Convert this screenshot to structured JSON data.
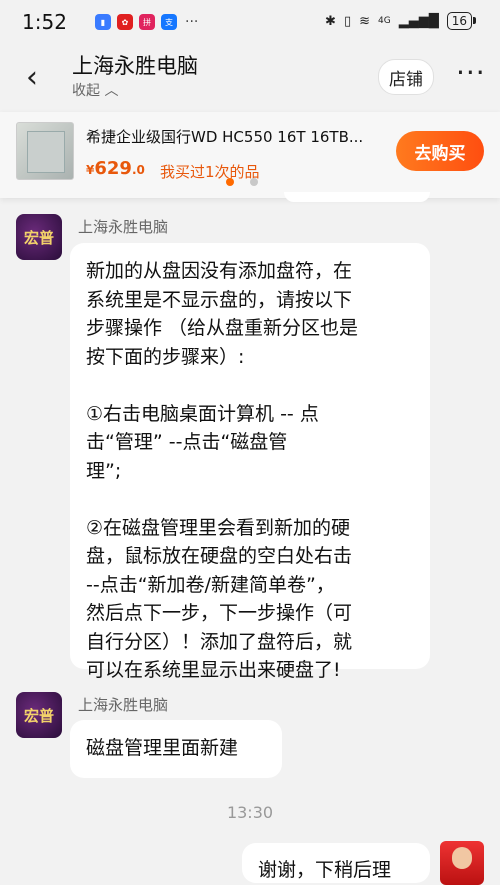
{
  "status_bar": {
    "time": "1:52",
    "notification_icons": [
      "voice-app-icon",
      "huawei-app-icon",
      "pinduoduo-app-icon",
      "alipay-app-icon"
    ],
    "more": "···",
    "network": "4G",
    "battery": "16"
  },
  "header": {
    "shop_name": "上海永胜电脑",
    "collapse_label": "收起",
    "store_button": "店铺",
    "more_button": "···"
  },
  "product": {
    "name": "希捷企业级国行WD HC550 16T 16TB...",
    "price_symbol": "¥",
    "price_int": "629",
    "price_dec": ".0",
    "bought_text": "我买过1次的品",
    "buy_button": "去购买",
    "carousel_dots": 2,
    "active_dot": 0
  },
  "messages": [
    {
      "sender": "上海永胜电脑",
      "avatar_text": "宏普",
      "lines": [
        "新加的从盘因没有添加盘符，在",
        "系统里是不显示盘的，请按以下",
        "步骤操作 （给从盘重新分区也是",
        "按下面的步骤来）:",
        "",
        "①右击电脑桌面计算机 -- 点",
        "击“管理” --点击“磁盘管",
        "理”;",
        "",
        "②在磁盘管理里会看到新加的硬",
        "盘，鼠标放在硬盘的空白处右击",
        "--点击“新加卷/新建简单卷”，",
        "然后点下一步，下一步操作（可",
        "自行分区）！添加了盘符后，就",
        "可以在系统里显示出来硬盘了!"
      ]
    },
    {
      "sender": "上海永胜电脑",
      "avatar_text": "宏普",
      "lines": [
        "磁盘管理里面新建"
      ]
    }
  ],
  "timestamp": "13:30",
  "my_message_partial": "谢谢，下稍后理",
  "colors": {
    "accent": "#ff6a00",
    "price": "#e8580c",
    "background": "#f2f2f2"
  }
}
